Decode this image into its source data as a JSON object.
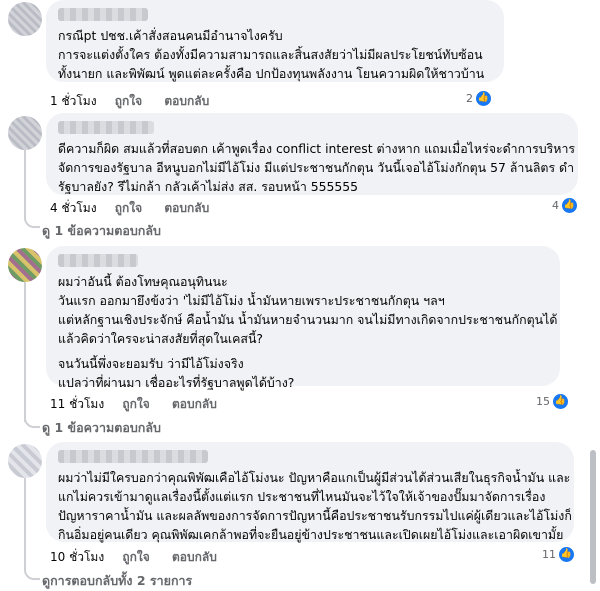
{
  "comments": [
    {
      "lines": [
        "กรณีpt ปชช.เค้าสั่งสอนคนมีอำนาจไงครับ",
        "การจะแต่งตั้งใคร ต้องทั้งมีความสามารถและสิ้นสงสัยว่าไม่มีผลประโยชน์ทับซ้อน",
        "ทั้งนายก และพิพัฒน์ พูดแต่ละครั้งคือ ปกป้องทุนพลังงาน โยนความผิดให้ชาวบ้าน"
      ],
      "time": "1 ชั่วโมง",
      "like": "ถูกใจ",
      "reply": "ตอบกลับ",
      "reactions": "2"
    },
    {
      "lines": [
        "ดีความก็ผิด สมแล้วที่สอบตก เค้าพูดเรื่อง conflict interest ต่างหาก แถมเมื่อไหร่จะดำการบริหาร",
        "จัดการของรัฐบาล อีหนูบอกไม่มีไอ้โม่ง มีแต่ประชาชนกักตุน วันนี้เจอไอ้โม่งกักตุน 57 ล้านลิตร ดำ",
        "รัฐบาลยัง? รึไม่กล้า กลัวเค้าไม่ส่ง สส. รอบหน้า 555555"
      ],
      "time": "4 ชั่วโมง",
      "like": "ถูกใจ",
      "reply": "ตอบกลับ",
      "reactions": "4",
      "replies_link": "ดู 1 ข้อความตอบกลับ"
    },
    {
      "lines": [
        "ผมว่าอันนี้ ต้องโทษคุณอนุทินนะ",
        "วันแรก ออกมายึงข้งว่า 'ไม่มีไอ้โม่ง น้ำมันหายเพราะประชาชนกักตุน ฯลฯ",
        "แต่หลักฐานเชิงประจักษ์ คือน้ำมัน น้ำมันหายจำนวนมาก จนไม่มีทางเกิดจากประชาชนกักตุนได้",
        "แล้วคิดว่าใครจะน่าสงสัยที่สุดในเคสนี้?",
        "",
        "จนวันนี้พึ่งจะยอมรับ ว่ามีไอ้โม่งจริง",
        "แปลว่าที่ผ่านมา เชื่ออะไรที่รัฐบาลพูดได้บ้าง?"
      ],
      "time": "11 ชั่วโมง",
      "like": "ถูกใจ",
      "reply": "ตอบกลับ",
      "reactions": "15",
      "replies_link": "ดู 1 ข้อความตอบกลับ"
    },
    {
      "lines": [
        "ผมว่าไม่มีใครบอกว่าคุณพิพัฒเคือไอ้โม่งนะ ปัญหาคือแกเป็นผู้มีส่วนได้ส่วนเสียในธุรกิจน้ำมัน และ",
        "แกไม่ควรเข้ามาดูแลเรื่องนี้ตั้งแต่แรก ประชาชนที่ไหนมันจะไว้ใจให้เจ้าของปั๊มมาจัดการเรื่อง",
        "ปัญหาราคาน้ำมัน และผลลัพของการจัดการปัญหานี้คือประชาชนรับกรรมไปแค่ผู้เดียวและไอ้โม่งก็",
        "กินอิ่มอยู่คนเดียว คุณพิพัฒเคกล้าพอที่จะยืนอยู่ข้างประชาชนและเปิดเผยไอ้โม่งและเอาผิดเขามั้ย"
      ],
      "time": "10 ชั่วโมง",
      "like": "ถูกใจ",
      "reply": "ตอบกลับ",
      "reactions": "11",
      "replies_link": "ดูการตอบกลับทั้ง 2 รายการ"
    }
  ],
  "colors": {
    "bubble": "#f0f2f5",
    "link": "#65676b",
    "like_blue": "#1877f2"
  },
  "icons": {
    "like": "thumbs-up-icon",
    "reply_arrow": "reply-arrow-icon",
    "more": "more-options-icon"
  }
}
